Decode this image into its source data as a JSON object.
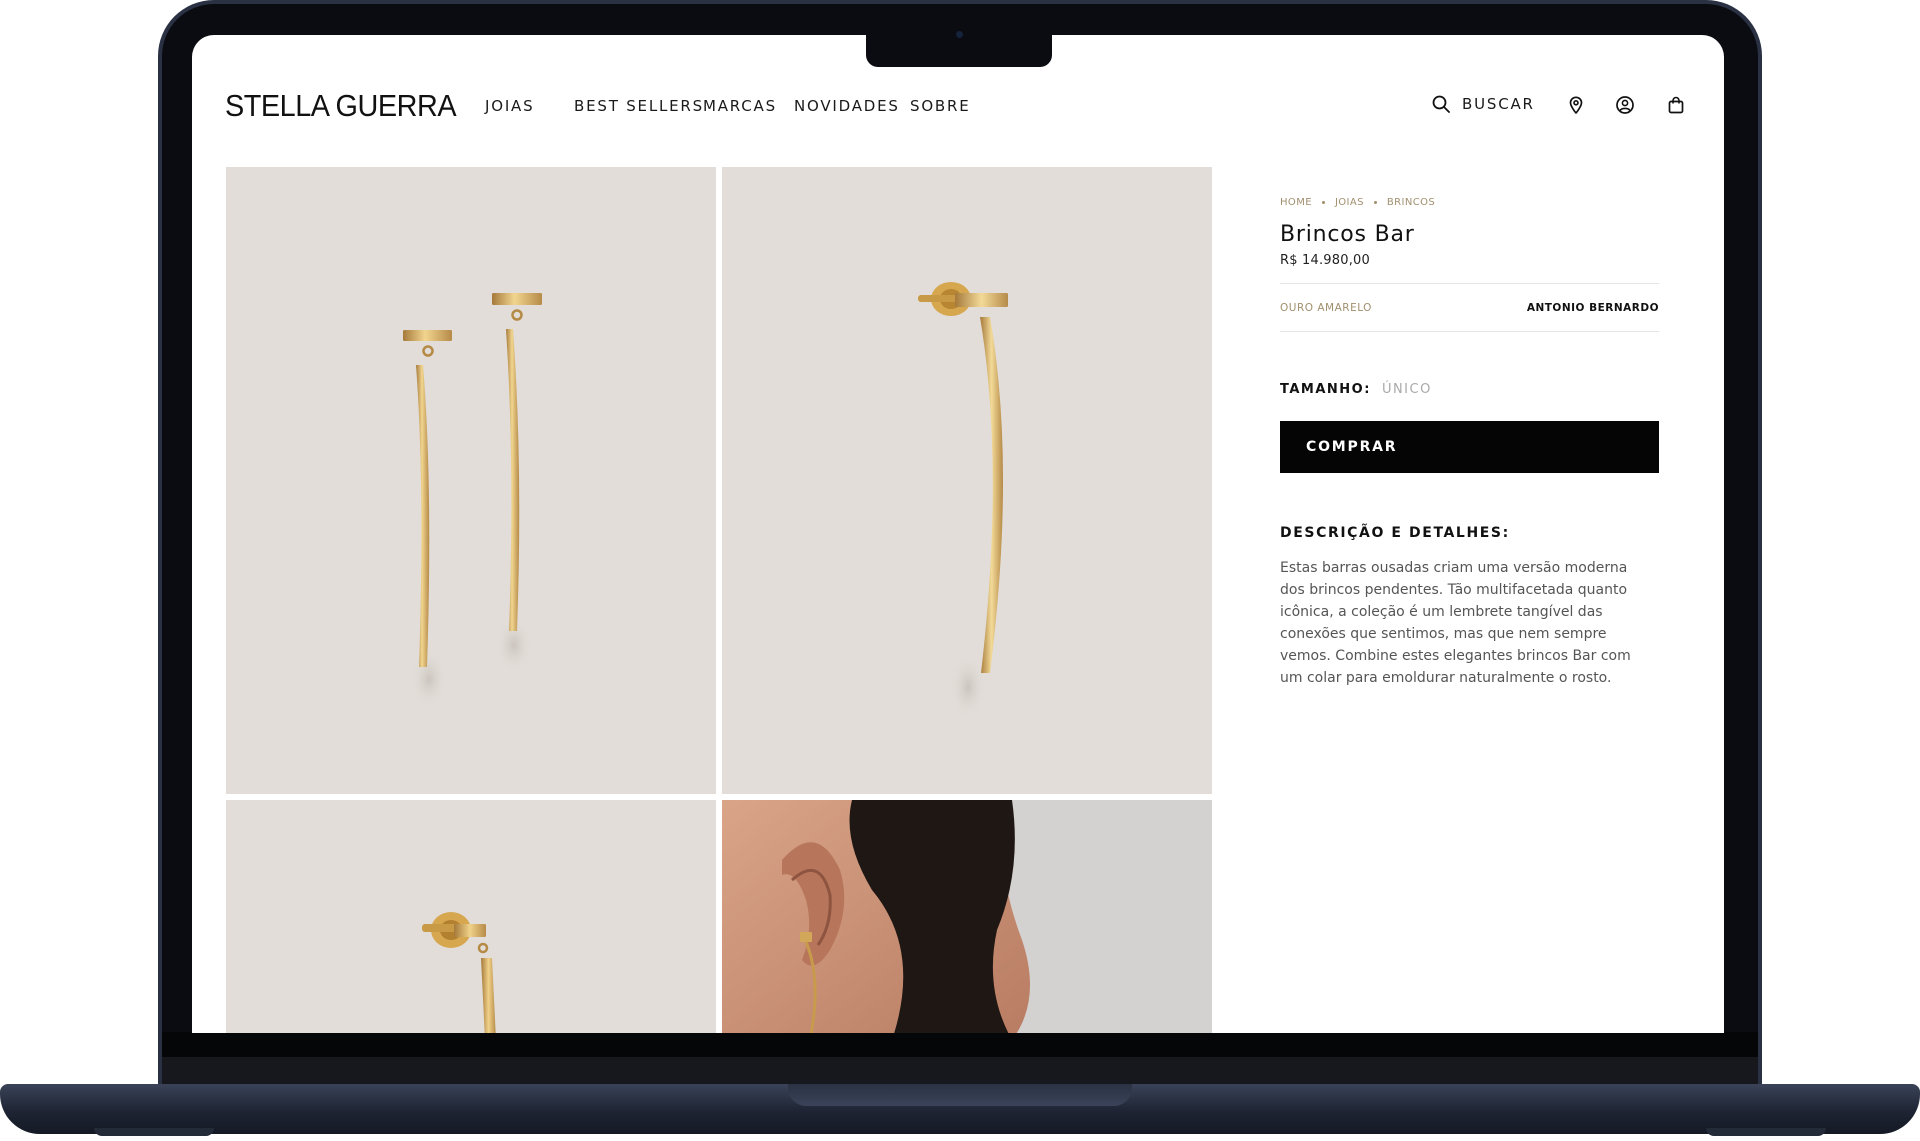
{
  "brand": {
    "logo_text": "STELLA GUERRA"
  },
  "nav": {
    "items": [
      {
        "label": "JOIAS"
      },
      {
        "label": "BEST SELLERS"
      },
      {
        "label": "MARCAS"
      },
      {
        "label": "NOVIDADES"
      },
      {
        "label": "SOBRE"
      }
    ]
  },
  "header_tools": {
    "search_label": "BUSCAR",
    "icons": [
      "search-icon",
      "location-pin-icon",
      "account-icon",
      "shopping-bag-icon"
    ]
  },
  "gallery": {
    "photos": [
      {
        "name": "pair of gold bar earrings"
      },
      {
        "name": "single gold bar earring with backing"
      },
      {
        "name": "earring backing close-up"
      },
      {
        "name": "earring worn on ear"
      }
    ]
  },
  "product": {
    "breadcrumb": [
      "HOME",
      "JOIAS",
      "BRINCOS"
    ],
    "title": "Brincos Bar",
    "price": "R$ 14.980,00",
    "material": "OURO AMARELO",
    "designer": "ANTONIO BERNARDO",
    "size_label": "TAMANHO:",
    "size_value": "ÚNICO",
    "buy_label": "COMPRAR",
    "description_heading": "DESCRIÇÃO E DETALHES:",
    "description": "Estas barras ousadas criam uma versão moderna dos brincos pendentes. Tão multifacetada quanto icônica, a coleção é um lembrete tangível das conexões que sentimos, mas que nem sempre vemos. Combine estes elegantes brincos Bar com um colar para emoldurar naturalmente o rosto."
  },
  "colors": {
    "accent_gold": "#a18f6e",
    "button_black": "#050505",
    "photo_background": "#e2ddd8",
    "laptop_frame": "#0a0c12"
  }
}
